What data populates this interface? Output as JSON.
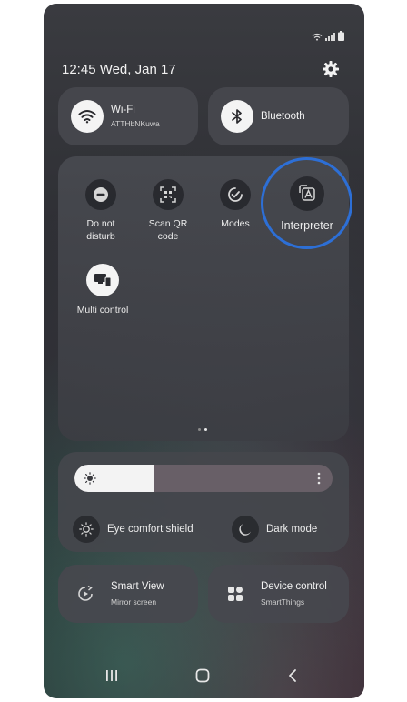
{
  "status_bar": {
    "icons": [
      "wifi-icon",
      "signal-icon",
      "battery-icon"
    ]
  },
  "header": {
    "clock": "12:45 Wed, Jan 17",
    "settings_icon": "gear-icon"
  },
  "top_tiles": {
    "wifi": {
      "title": "Wi-Fi",
      "subtitle": "ATTHbNKuwa",
      "icon": "wifi-icon",
      "state": "on"
    },
    "bluetooth": {
      "title": "Bluetooth",
      "icon": "bluetooth-icon",
      "state": "on"
    }
  },
  "quick_settings": {
    "items": [
      {
        "label": "Do not disturb",
        "icon": "do-not-disturb-icon",
        "state": "off"
      },
      {
        "label": "Scan QR code",
        "icon": "qr-scan-icon",
        "state": "off"
      },
      {
        "label": "Modes",
        "icon": "modes-icon",
        "state": "off"
      },
      {
        "label": "Interpreter",
        "icon": "interpreter-icon",
        "state": "off",
        "highlighted": true
      },
      {
        "label": "Multi control",
        "icon": "multi-control-icon",
        "state": "on"
      }
    ],
    "pages": 2,
    "current_page": 2
  },
  "brightness": {
    "level": 0.31,
    "icon": "sun-icon",
    "more_icon": "more-options-icon"
  },
  "toggles": {
    "eye_comfort": {
      "label": "Eye comfort shield",
      "icon": "eye-comfort-icon"
    },
    "dark_mode": {
      "label": "Dark mode",
      "icon": "moon-icon"
    }
  },
  "bottom_tiles": {
    "smart_view": {
      "title": "Smart View",
      "subtitle": "Mirror screen",
      "icon": "smart-view-icon"
    },
    "device_control": {
      "title": "Device control",
      "subtitle": "SmartThings",
      "icon": "device-control-icon"
    }
  },
  "navigation": {
    "buttons": [
      "recent-apps-icon",
      "home-icon",
      "back-icon"
    ]
  },
  "colors": {
    "highlight_ring": "#2d6fd6",
    "tile_background": "#46484e",
    "active_icon_bg": "#f4f4f4"
  }
}
